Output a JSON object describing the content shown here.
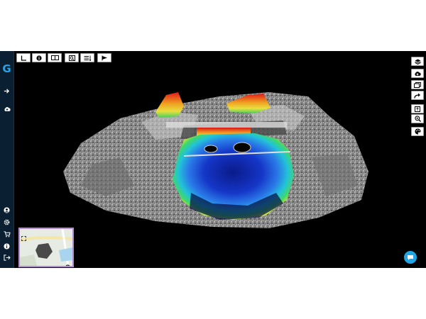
{
  "app": {
    "logo": "G"
  },
  "sidebar": {
    "top_items": [
      {
        "name": "arrow-right-icon"
      },
      {
        "name": "cloud-upload-icon"
      }
    ],
    "bottom_items": [
      {
        "name": "user-icon"
      },
      {
        "name": "gear-icon"
      },
      {
        "name": "cart-icon"
      },
      {
        "name": "info-icon"
      },
      {
        "name": "logout-icon"
      }
    ]
  },
  "top_toolbar": [
    {
      "name": "measure-angle-icon"
    },
    {
      "name": "info-icon"
    },
    {
      "name": "split-view-icon"
    },
    {
      "name": "zoom-box-icon"
    },
    {
      "name": "list-settings-icon"
    },
    {
      "name": "flag-icon"
    }
  ],
  "right_toolbar": [
    {
      "name": "layers-icon"
    },
    {
      "name": "cloud-download-icon"
    },
    {
      "name": "gallery-icon"
    },
    {
      "name": "share-icon"
    },
    {
      "name": "fit-view-icon"
    },
    {
      "name": "zoom-icon"
    },
    {
      "name": "palette-icon"
    }
  ],
  "colors": {
    "sidebar": "#0b1f33",
    "accent": "#2aa3e0",
    "background": "#000000",
    "minimap_border": "#b78ad6",
    "chat": "#1ea7e4"
  }
}
